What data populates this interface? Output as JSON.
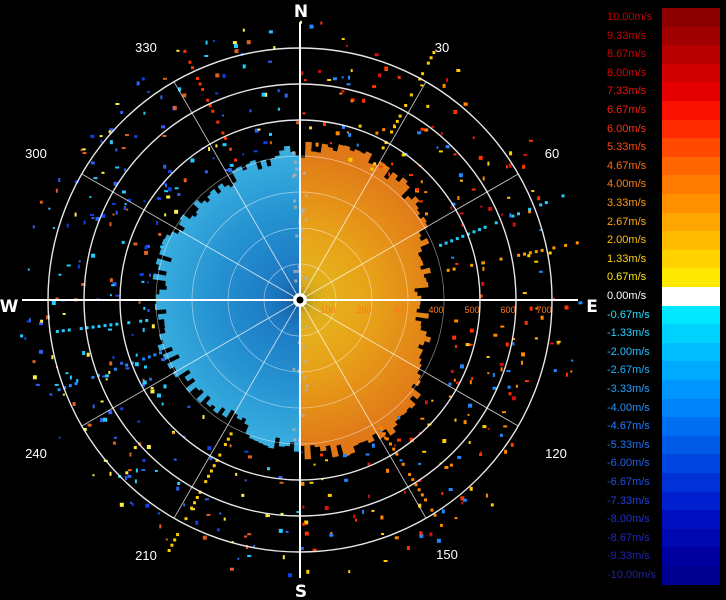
{
  "radar": {
    "cardinals": {
      "n": "N",
      "e": "E",
      "s": "S",
      "w": "W"
    },
    "bearings": {
      "b30": "30",
      "b60": "60",
      "b120": "120",
      "b150": "150",
      "b210": "210",
      "b240": "240",
      "b300": "300",
      "b330": "330"
    },
    "range_labels": {
      "r100": "100",
      "r200": "200",
      "r300": "300",
      "r400": "400",
      "r500": "500",
      "r600": "600",
      "r700": "700"
    },
    "colors": {
      "ring": "#ffffff",
      "axis": "#ffffff",
      "approach": "#1e9ee0",
      "recede": "#ee9a10"
    }
  },
  "legend": {
    "items": [
      {
        "label": "10.00m/s",
        "color": "#8b0000",
        "text": "#c00000"
      },
      {
        "label": "9.33m/s",
        "color": "#a00000",
        "text": "#c80000"
      },
      {
        "label": "8.67m/s",
        "color": "#b80000",
        "text": "#d00000"
      },
      {
        "label": "8.00m/s",
        "color": "#d00000",
        "text": "#e00000"
      },
      {
        "label": "7.33m/s",
        "color": "#e40000",
        "text": "#ee1010"
      },
      {
        "label": "6.67m/s",
        "color": "#f81000",
        "text": "#ff2010"
      },
      {
        "label": "6.00m/s",
        "color": "#ff2a00",
        "text": "#ff3010"
      },
      {
        "label": "5.33m/s",
        "color": "#ff4800",
        "text": "#ff4a10"
      },
      {
        "label": "4.67m/s",
        "color": "#ff6600",
        "text": "#ff6a10"
      },
      {
        "label": "4.00m/s",
        "color": "#ff7a00",
        "text": "#ff8010"
      },
      {
        "label": "3.33m/s",
        "color": "#ff9000",
        "text": "#ff9a10"
      },
      {
        "label": "2.67m/s",
        "color": "#ffa600",
        "text": "#ffaa10"
      },
      {
        "label": "2.00m/s",
        "color": "#ffbc00",
        "text": "#ffbe10"
      },
      {
        "label": "1.33m/s",
        "color": "#ffd200",
        "text": "#ffd210"
      },
      {
        "label": "0.67m/s",
        "color": "#ffe800",
        "text": "#ffe810"
      },
      {
        "label": "0.00m/s",
        "color": "#ffffff",
        "text": "#ffffff"
      },
      {
        "label": "-0.67m/s",
        "color": "#00e8ff",
        "text": "#20e0ff"
      },
      {
        "label": "-1.33m/s",
        "color": "#00d2ff",
        "text": "#20d0ff"
      },
      {
        "label": "-2.00m/s",
        "color": "#00beff",
        "text": "#20c0ff"
      },
      {
        "label": "-2.67m/s",
        "color": "#00aaff",
        "text": "#20b0ff"
      },
      {
        "label": "-3.33m/s",
        "color": "#0096ff",
        "text": "#20a0ff"
      },
      {
        "label": "-4.00m/s",
        "color": "#0082f8",
        "text": "#2090ff"
      },
      {
        "label": "-4.67m/s",
        "color": "#006ef0",
        "text": "#2080ff"
      },
      {
        "label": "-5.33m/s",
        "color": "#005ae8",
        "text": "#2070f0"
      },
      {
        "label": "-6.00m/s",
        "color": "#0046e0",
        "text": "#2060e8"
      },
      {
        "label": "-6.67m/s",
        "color": "#0032d8",
        "text": "#2050e0"
      },
      {
        "label": "-7.33m/s",
        "color": "#0020d0",
        "text": "#2040d8"
      },
      {
        "label": "-8.00m/s",
        "color": "#0010c0",
        "text": "#2030d0"
      },
      {
        "label": "-8.67m/s",
        "color": "#0008b0",
        "text": "#2028c0"
      },
      {
        "label": "-9.33m/s",
        "color": "#0000a0",
        "text": "#2020b0"
      },
      {
        "label": "-10.00m/s",
        "color": "#000090",
        "text": "#2020a0"
      }
    ]
  }
}
